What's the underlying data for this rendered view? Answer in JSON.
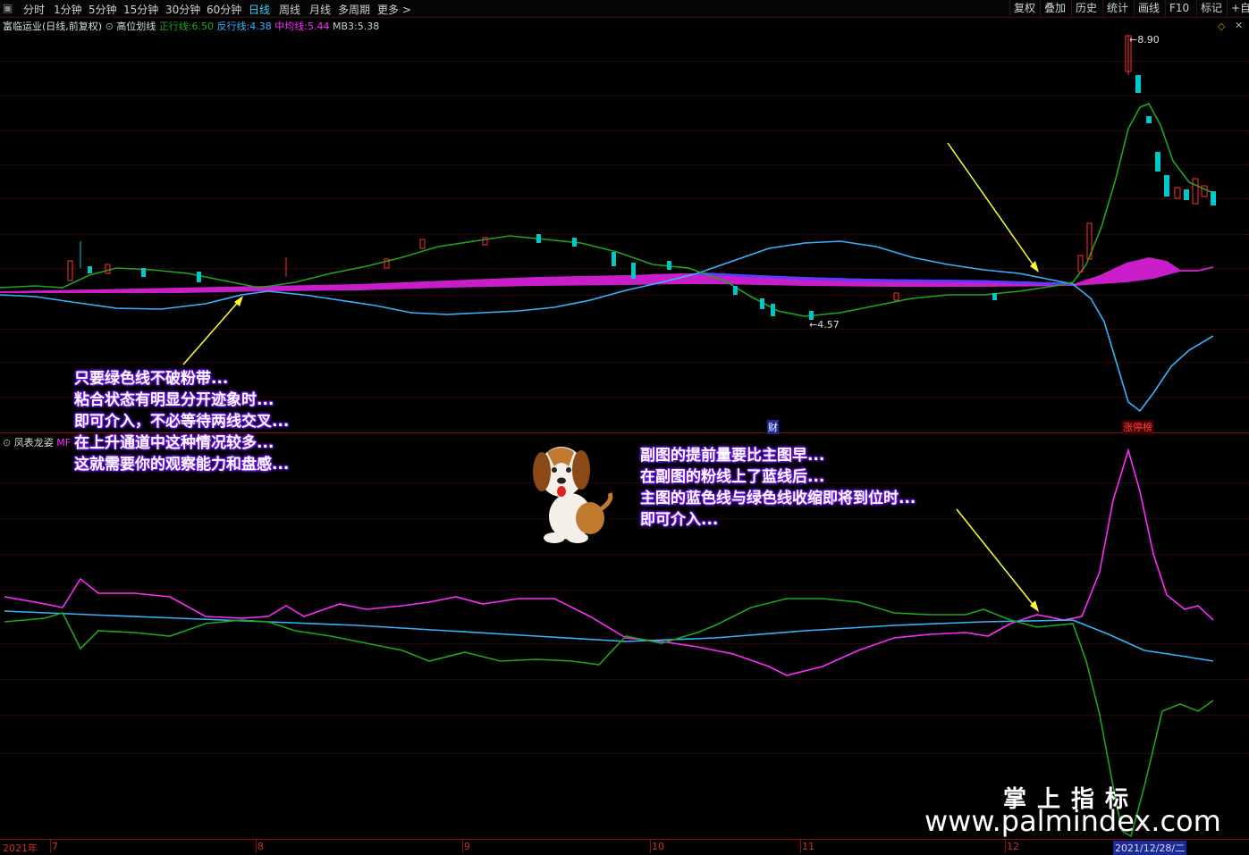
{
  "toolbar": {
    "periods": [
      "分时",
      "1分钟",
      "5分钟",
      "15分钟",
      "30分钟",
      "60分钟",
      "日线",
      "周线",
      "月线",
      "多周期",
      "更多 >"
    ],
    "active_period": "日线",
    "right_buttons": [
      "复权",
      "叠加",
      "历史",
      "统计",
      "画线",
      "F10",
      "标记",
      "+自"
    ]
  },
  "main_chart": {
    "stock_title": "富临运业(日线,前复权)",
    "indicator": "高位划线",
    "lines": [
      {
        "label": "正行线:",
        "value": "6.50",
        "color": "#1fa51f"
      },
      {
        "label": "反行线:",
        "value": "4.38",
        "color": "#36b4ff"
      },
      {
        "label": "中均线:",
        "value": "5.44",
        "color": "#ff2cff"
      },
      {
        "label": "MB3:",
        "value": "5.38",
        "color": "#cccccc"
      }
    ],
    "high_label": "8.90",
    "low_label": "4.57",
    "markers": {
      "cai": "财",
      "zhangting": "涨停榜"
    }
  },
  "sub_chart": {
    "indicator": "凤表龙姿",
    "tag": "MF"
  },
  "annotations": {
    "left_note": [
      "只要绿色线不破粉带...",
      "粘合状态有明显分开迹象时...",
      "即可介入，不必等待两线交叉...",
      "在上升通道中这种情况较多...",
      "这就需要你的观察能力和盘感..."
    ],
    "right_note": [
      "副图的提前量要比主图早...",
      "在副图的粉线上了蓝线后...",
      "主图的蓝色线与绿色线收缩即将到位时...",
      "即可介入..."
    ]
  },
  "axis": {
    "year": "2021年",
    "months": [
      "7",
      "8",
      "9",
      "10",
      "11",
      "12"
    ],
    "selected_date": "2021/12/28/二"
  },
  "watermark": {
    "cn": "掌上指标",
    "url": "www.palmindex.com"
  },
  "colors": {
    "up": "#ff3030",
    "down": "#00c8c8",
    "green": "#1fa51f",
    "blue": "#36b4ff",
    "pink": "#ff2cff",
    "purple": "#a020f0",
    "arrow": "#ffff30"
  }
}
